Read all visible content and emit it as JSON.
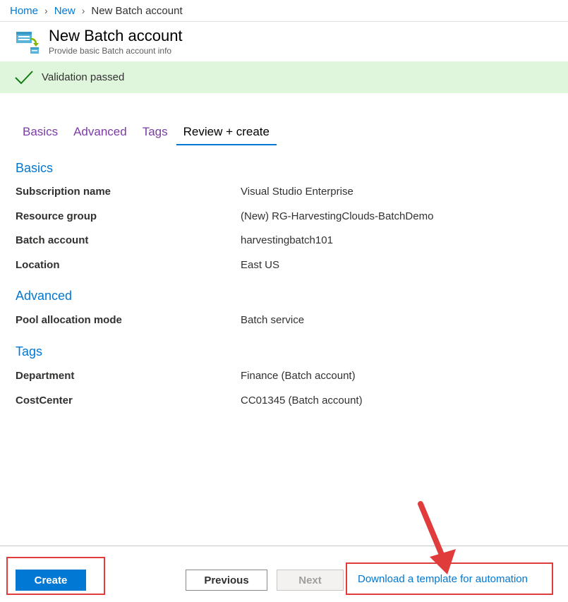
{
  "breadcrumb": {
    "items": [
      "Home",
      "New"
    ],
    "current": "New Batch account"
  },
  "header": {
    "icon": "batch-account-icon",
    "title": "New Batch account",
    "subtitle": "Provide basic Batch account info"
  },
  "validation": {
    "icon": "checkmark-icon",
    "text": "Validation passed"
  },
  "tabs": [
    {
      "label": "Basics",
      "active": false
    },
    {
      "label": "Advanced",
      "active": false
    },
    {
      "label": "Tags",
      "active": false
    },
    {
      "label": "Review + create",
      "active": true
    }
  ],
  "summary": {
    "basics": {
      "title": "Basics",
      "rows": [
        {
          "label": "Subscription name",
          "value": "Visual Studio Enterprise"
        },
        {
          "label": "Resource group",
          "value": "(New) RG-HarvestingClouds-BatchDemo"
        },
        {
          "label": "Batch account",
          "value": "harvestingbatch101"
        },
        {
          "label": "Location",
          "value": "East US"
        }
      ]
    },
    "advanced": {
      "title": "Advanced",
      "rows": [
        {
          "label": "Pool allocation mode",
          "value": "Batch service"
        }
      ]
    },
    "tags": {
      "title": "Tags",
      "rows": [
        {
          "label": "Department",
          "value": "Finance (Batch account)"
        },
        {
          "label": "CostCenter",
          "value": "CC01345 (Batch account)"
        }
      ]
    }
  },
  "footer": {
    "create_label": "Create",
    "previous_label": "Previous",
    "next_label": "Next",
    "download_label": "Download a template for automation"
  },
  "colors": {
    "accent": "#0078d4",
    "validation_bg": "#dff6dd",
    "check": "#107c10",
    "tab_inactive": "#7b3ca3",
    "annotation": "#e03c3c"
  }
}
